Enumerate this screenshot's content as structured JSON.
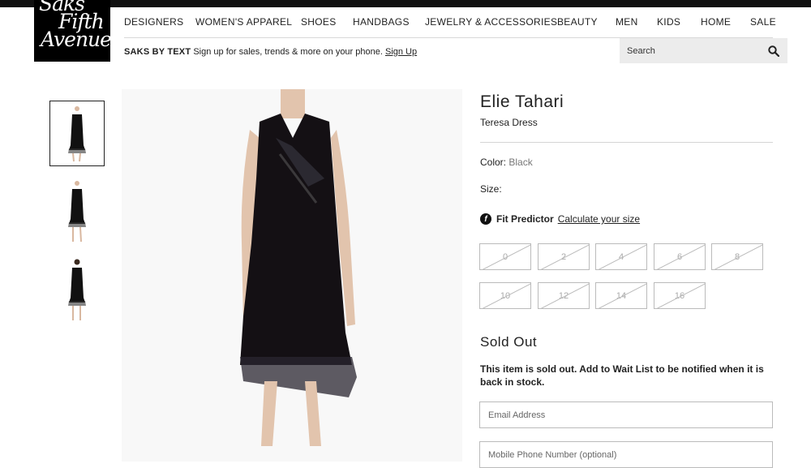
{
  "header": {
    "logo_lines": [
      "Saks",
      "Fifth",
      "Avenue"
    ],
    "nav": [
      "DESIGNERS",
      "WOMEN'S APPAREL",
      "SHOES",
      "HANDBAGS",
      "JEWELRY & ACCESSORIES",
      "BEAUTY",
      "MEN",
      "KIDS",
      "HOME",
      "SALE"
    ],
    "saks_by_text": {
      "label": "SAKS BY TEXT",
      "message": " Sign up for sales, trends & more on your phone. ",
      "link": "Sign Up"
    },
    "search": {
      "placeholder": "Search",
      "icon": "search-icon"
    }
  },
  "gallery": {
    "thumbnails": [
      {
        "alt": "front view",
        "active": true
      },
      {
        "alt": "full length view",
        "active": false
      },
      {
        "alt": "back view",
        "active": false
      }
    ],
    "main_image_alt": "Elie Tahari Teresa Dress in black velvet"
  },
  "product": {
    "brand": "Elie Tahari",
    "name": "Teresa Dress",
    "color_label": "Color:",
    "color_value": "Black",
    "size_label": "Size:",
    "fit_predictor": {
      "label": "Fit Predictor",
      "link": "Calculate your size"
    },
    "sizes": [
      "0",
      "2",
      "4",
      "6",
      "8",
      "10",
      "12",
      "14",
      "16"
    ],
    "sold_out_title": "Sold Out",
    "sold_out_message": "This item is sold out. Add to Wait List to be notified when it is back in stock.",
    "email_placeholder": "Email Address",
    "phone_placeholder": "Mobile Phone Number (optional)"
  },
  "colors": {
    "accent": "#000000",
    "size_disabled": "#aaaaaa",
    "divider": "#d4d4d4"
  }
}
